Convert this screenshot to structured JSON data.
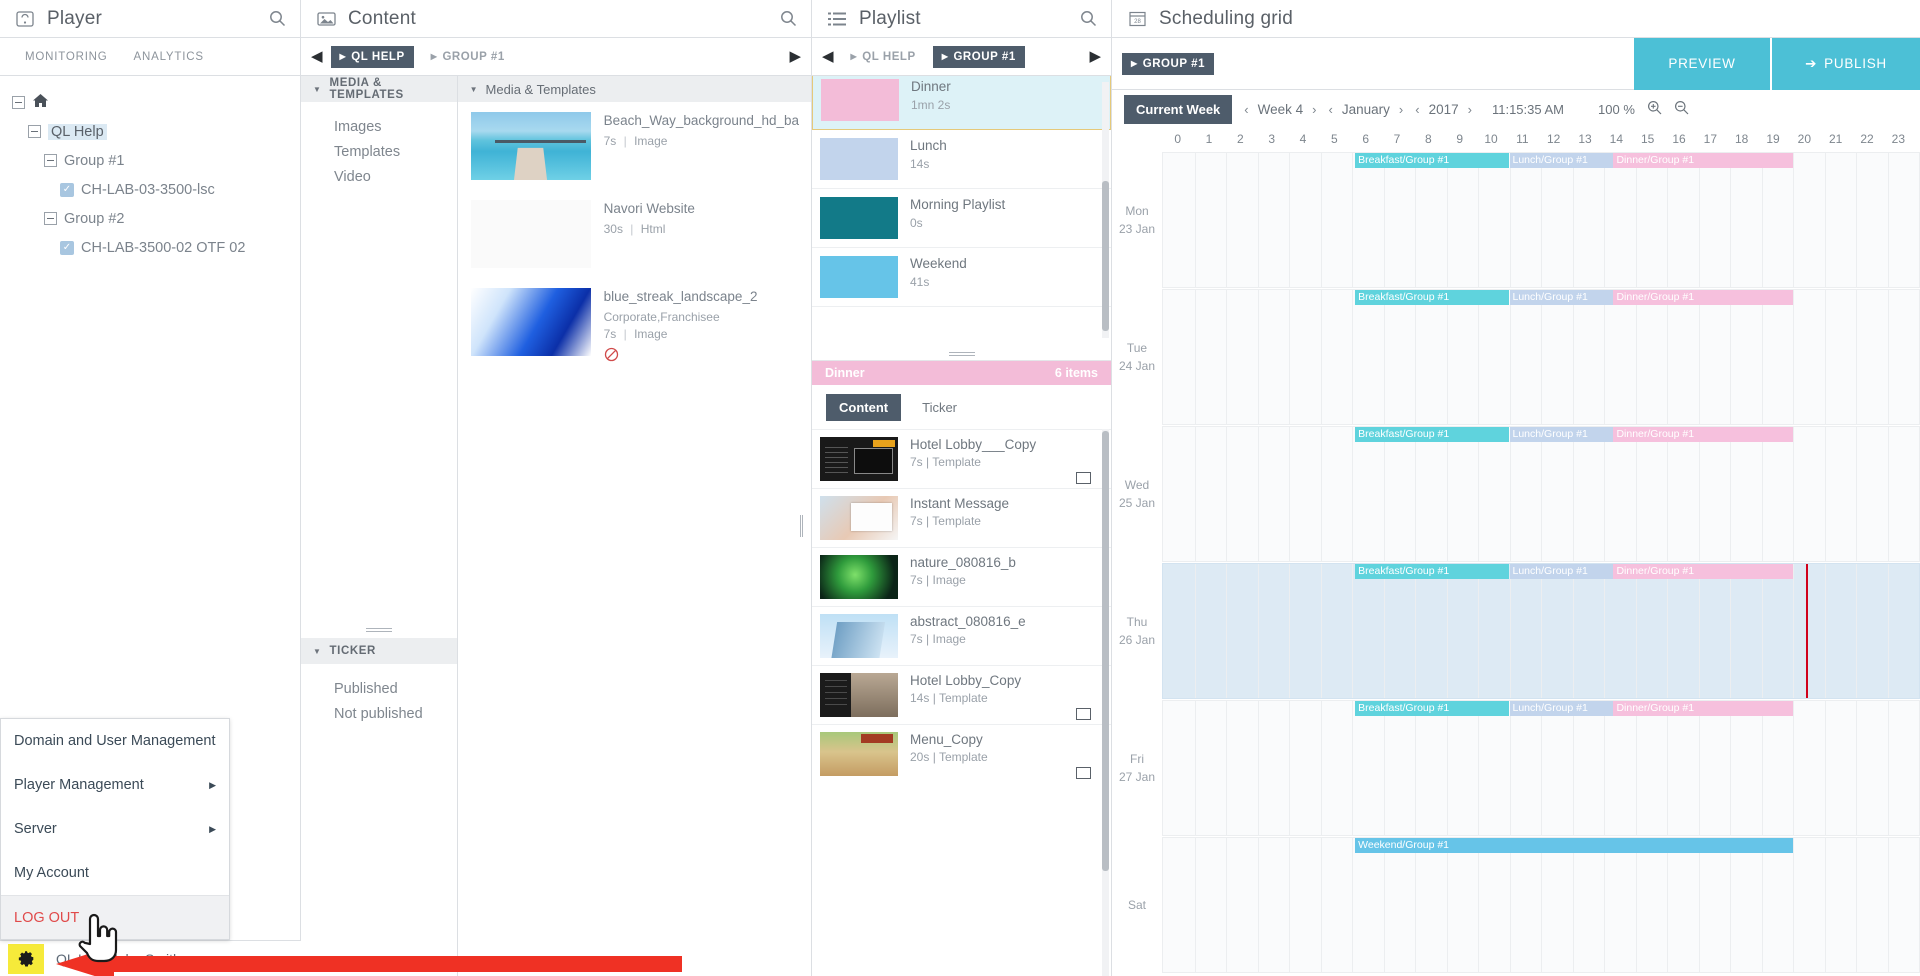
{
  "player": {
    "title": "Player",
    "icon": "player-icon",
    "search_icon": "search-icon",
    "tabs": [
      {
        "label": "MONITORING"
      },
      {
        "label": "ANALYTICS"
      }
    ],
    "tree": [
      {
        "label": "",
        "icon": "home-icon",
        "level": 0,
        "type": "home"
      },
      {
        "label": "QL Help",
        "level": 1,
        "type": "node",
        "selected": true
      },
      {
        "label": "Group #1",
        "level": 2,
        "type": "node"
      },
      {
        "label": "CH-LAB-03-3500-lsc",
        "level": 3,
        "type": "leaf",
        "checked": true
      },
      {
        "label": "Group #2",
        "level": 2,
        "type": "node"
      },
      {
        "label": "CH-LAB-3500-02 OTF 02",
        "level": 3,
        "type": "leaf",
        "checked": true
      }
    ],
    "user_menu": [
      {
        "label": "Domain and User Management",
        "submenu": false
      },
      {
        "label": "Player Management",
        "submenu": true
      },
      {
        "label": "Server",
        "submenu": true
      },
      {
        "label": "My Account",
        "submenu": false
      },
      {
        "label": "LOG OUT",
        "submenu": false,
        "danger": true
      }
    ],
    "user_bar": {
      "gear_icon": "gear-icon",
      "path": "QL Help/John Smith"
    }
  },
  "content": {
    "title": "Content",
    "icon": "image-icon",
    "search_icon": "search-icon",
    "breadcrumbs": [
      {
        "label": "QL HELP",
        "active": true
      },
      {
        "label": "GROUP #1",
        "active": false
      }
    ],
    "left_sections": [
      {
        "title": "MEDIA & TEMPLATES",
        "items": [
          {
            "label": "Images"
          },
          {
            "label": "Templates"
          },
          {
            "label": "Video"
          }
        ]
      },
      {
        "title": "TICKER",
        "items": [
          {
            "label": "Published"
          },
          {
            "label": "Not published"
          }
        ]
      }
    ],
    "list_title": "Media & Templates",
    "media": [
      {
        "name": "Beach_Way_background_hd_ba",
        "tags": "",
        "duration": "7s",
        "kind": "Image",
        "restricted": false,
        "thumb": "beach-pier"
      },
      {
        "name": "Navori Website",
        "tags": "",
        "duration": "30s",
        "kind": "Html",
        "restricted": false,
        "thumb": "blank-white"
      },
      {
        "name": "blue_streak_landscape_2",
        "tags": "Corporate,Franchisee",
        "duration": "7s",
        "kind": "Image",
        "restricted": true,
        "thumb": "blue-streak"
      }
    ]
  },
  "playlist": {
    "title": "Playlist",
    "icon": "list-icon",
    "search_icon": "search-icon",
    "breadcrumbs": [
      {
        "label": "QL HELP",
        "active": false
      },
      {
        "label": "GROUP #1",
        "active": true
      }
    ],
    "playlists": [
      {
        "name": "Dinner",
        "duration": "1mn 2s",
        "color": "#f3bcd8",
        "selected": true
      },
      {
        "name": "Lunch",
        "duration": "14s",
        "color": "#c2d4ec",
        "selected": false
      },
      {
        "name": "Morning Playlist",
        "duration": "0s",
        "color": "#127a88",
        "selected": false
      },
      {
        "name": "Weekend",
        "duration": "41s",
        "color": "#66c4e8",
        "selected": false
      }
    ],
    "selected_bar": {
      "name": "Dinner",
      "count": "6 items",
      "color": "#f3bcd8"
    },
    "tabs": [
      {
        "label": "Content",
        "active": true
      },
      {
        "label": "Ticker",
        "active": false
      }
    ],
    "items": [
      {
        "name": "Hotel Lobby___Copy",
        "duration": "7s",
        "kind": "Template",
        "badge": true,
        "thumb": "hotel-lobby-dark"
      },
      {
        "name": "Instant Message",
        "duration": "7s",
        "kind": "Template",
        "badge": false,
        "thumb": "hand-card"
      },
      {
        "name": "nature_080816_b",
        "duration": "7s",
        "kind": "Image",
        "badge": false,
        "thumb": "aurora"
      },
      {
        "name": "abstract_080816_e",
        "duration": "7s",
        "kind": "Image",
        "badge": false,
        "thumb": "glass-building"
      },
      {
        "name": "Hotel Lobby_Copy",
        "duration": "14s",
        "kind": "Template",
        "badge": true,
        "thumb": "hotel-lobby-street"
      },
      {
        "name": "Menu_Copy",
        "duration": "20s",
        "kind": "Template",
        "badge": true,
        "thumb": "wood-menu"
      }
    ]
  },
  "scheduling": {
    "title": "Scheduling grid",
    "icon": "calendar-icon",
    "breadcrumbs": [
      {
        "label": "GROUP #1",
        "active": true
      }
    ],
    "actions": [
      {
        "label": "PREVIEW",
        "icon": ""
      },
      {
        "label": "PUBLISH",
        "icon": "arrow-right-icon"
      }
    ],
    "toolbar": {
      "current_week_label": "Current Week",
      "week": "Week 4",
      "month": "January",
      "year": "2017",
      "time": "11:15:35 AM",
      "zoom": "100 %",
      "zoom_in_icon": "zoom-in-icon",
      "zoom_out_icon": "zoom-out-icon"
    },
    "accent_color": "#4cc0d6",
    "hours": [
      0,
      1,
      2,
      3,
      4,
      5,
      6,
      7,
      8,
      9,
      10,
      11,
      12,
      13,
      14,
      15,
      16,
      17,
      18,
      19,
      20,
      21,
      22,
      23
    ],
    "now_hour": 20.4,
    "days": [
      {
        "day": "Mon",
        "date": "23 Jan",
        "highlight": false,
        "now": false,
        "events": [
          {
            "label": "Breakfast/Group #1",
            "start": 6.1,
            "end": 11.0,
            "color": "#5fd3dd"
          },
          {
            "label": "Lunch/Group #1",
            "start": 11.0,
            "end": 14.3,
            "color": "#c2d4ec"
          },
          {
            "label": "Dinner/Group #1",
            "start": 14.3,
            "end": 20.0,
            "color": "#f6c0dd"
          }
        ]
      },
      {
        "day": "Tue",
        "date": "24 Jan",
        "highlight": false,
        "now": false,
        "events": [
          {
            "label": "Breakfast/Group #1",
            "start": 6.1,
            "end": 11.0,
            "color": "#5fd3dd"
          },
          {
            "label": "Lunch/Group #1",
            "start": 11.0,
            "end": 14.3,
            "color": "#c2d4ec"
          },
          {
            "label": "Dinner/Group #1",
            "start": 14.3,
            "end": 20.0,
            "color": "#f6c0dd"
          }
        ]
      },
      {
        "day": "Wed",
        "date": "25 Jan",
        "highlight": false,
        "now": false,
        "events": [
          {
            "label": "Breakfast/Group #1",
            "start": 6.1,
            "end": 11.0,
            "color": "#5fd3dd"
          },
          {
            "label": "Lunch/Group #1",
            "start": 11.0,
            "end": 14.3,
            "color": "#c2d4ec"
          },
          {
            "label": "Dinner/Group #1",
            "start": 14.3,
            "end": 20.0,
            "color": "#f6c0dd"
          }
        ]
      },
      {
        "day": "Thu",
        "date": "26 Jan",
        "highlight": true,
        "now": true,
        "events": [
          {
            "label": "Breakfast/Group #1",
            "start": 6.1,
            "end": 11.0,
            "color": "#5fd3dd"
          },
          {
            "label": "Lunch/Group #1",
            "start": 11.0,
            "end": 14.3,
            "color": "#c2d4ec"
          },
          {
            "label": "Dinner/Group #1",
            "start": 14.3,
            "end": 20.0,
            "color": "#f6c0dd"
          }
        ]
      },
      {
        "day": "Fri",
        "date": "27 Jan",
        "highlight": false,
        "now": false,
        "events": [
          {
            "label": "Breakfast/Group #1",
            "start": 6.1,
            "end": 11.0,
            "color": "#5fd3dd"
          },
          {
            "label": "Lunch/Group #1",
            "start": 11.0,
            "end": 14.3,
            "color": "#c2d4ec"
          },
          {
            "label": "Dinner/Group #1",
            "start": 14.3,
            "end": 20.0,
            "color": "#f6c0dd"
          }
        ]
      },
      {
        "day": "Sat",
        "date": "",
        "highlight": false,
        "now": false,
        "events": [
          {
            "label": "Weekend/Group #1",
            "start": 6.1,
            "end": 20.0,
            "color": "#66c4e8"
          }
        ]
      }
    ]
  },
  "annotations": {
    "arrow_color": "#ef3124",
    "cursor_icon": "hand-pointer-cursor",
    "arrow_icon": "arrow-left-annotation"
  }
}
